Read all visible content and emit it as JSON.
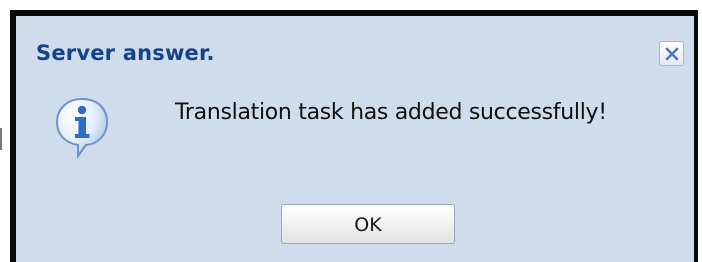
{
  "dialog": {
    "title": "Server answer.",
    "message": "Translation task has added successfully!",
    "ok_label": "OK",
    "icons": {
      "close": "close-icon",
      "message": "info-icon"
    },
    "colors": {
      "title": "#15428b",
      "background": "#cfdcec",
      "info_icon": "#2a6ec6",
      "close_icon": "#4a79c4"
    }
  }
}
